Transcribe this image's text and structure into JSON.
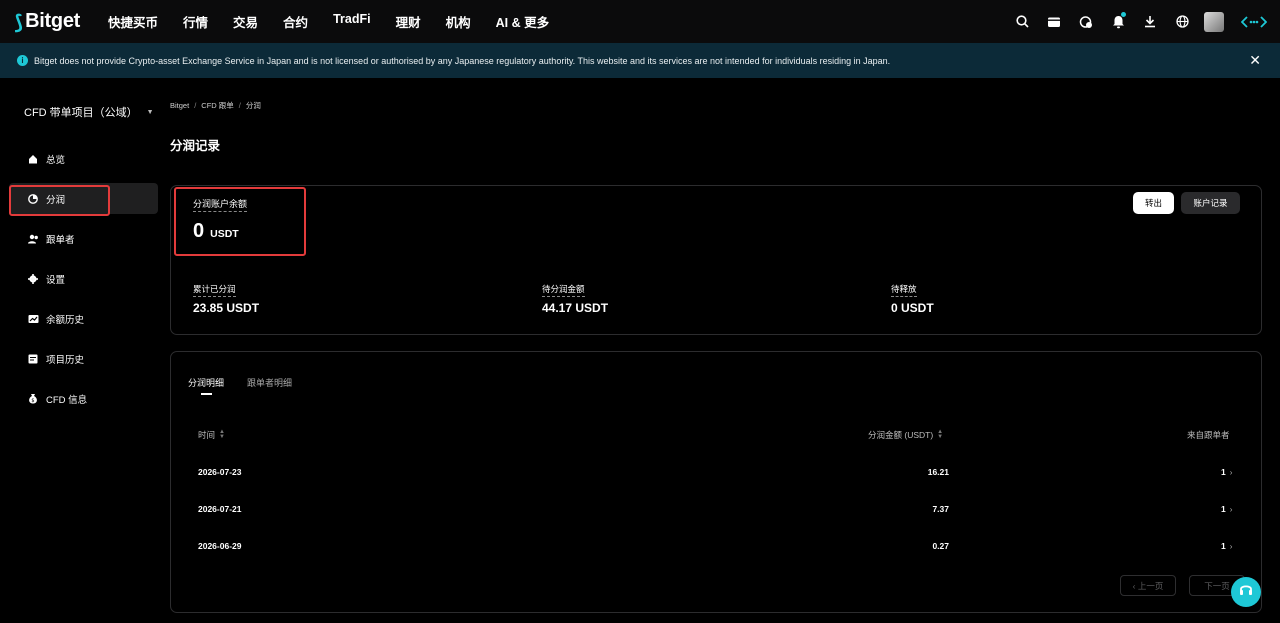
{
  "topnav": {
    "logo_text": "Bitget",
    "items": [
      "快捷买币",
      "行情",
      "交易",
      "合约",
      "TradFi",
      "理财",
      "机构",
      "AI & 更多"
    ],
    "icons": [
      "search-icon",
      "wallet-icon",
      "orders-icon",
      "bell-icon",
      "download-icon",
      "globe-icon",
      "avatar",
      "more-icon"
    ]
  },
  "banner": {
    "text": "Bitget does not provide Crypto-asset Exchange Service in Japan and is not licensed or authorised by any Japanese regulatory authority. This website and its services are not intended for individuals residing in Japan.",
    "close": "✕"
  },
  "sidebar": {
    "title": "CFD 带单项目（公域）",
    "items": [
      {
        "label": "总览",
        "icon": "home-icon"
      },
      {
        "label": "分润",
        "icon": "pie-chart-icon"
      },
      {
        "label": "跟单者",
        "icon": "users-icon"
      },
      {
        "label": "设置",
        "icon": "gear-icon"
      },
      {
        "label": "余额历史",
        "icon": "balance-history-icon"
      },
      {
        "label": "项目历史",
        "icon": "project-history-icon"
      },
      {
        "label": "CFD 信息",
        "icon": "money-bag-icon"
      }
    ]
  },
  "breadcrumb": [
    "Bitget",
    "CFD 跟单",
    "分润"
  ],
  "page_title": "分润记录",
  "balance": {
    "label": "分润账户余额",
    "value": "0",
    "unit": "USDT",
    "transfer_btn": "转出",
    "records_btn": "账户记录"
  },
  "stats": [
    {
      "label": "累计已分润",
      "value": "23.85 USDT"
    },
    {
      "label": "待分润金额",
      "value": "44.17 USDT"
    },
    {
      "label": "待释放",
      "value": "0 USDT"
    }
  ],
  "tabs": [
    "分润明细",
    "跟单者明细"
  ],
  "table": {
    "headers": [
      "时间",
      "分润金额 (USDT)",
      "来自跟单者"
    ],
    "rows": [
      {
        "date": "2026-07-23",
        "amount": "16.21",
        "followers": "1"
      },
      {
        "date": "2026-07-21",
        "amount": "7.37",
        "followers": "1"
      },
      {
        "date": "2026-06-29",
        "amount": "0.27",
        "followers": "1"
      }
    ]
  },
  "pagination": {
    "prev": "‹ 上一页",
    "next": "下一页"
  },
  "colors": {
    "accent": "#1ec8d6",
    "highlight_box": "#e33b3b",
    "banner_bg": "#0c2a38"
  }
}
